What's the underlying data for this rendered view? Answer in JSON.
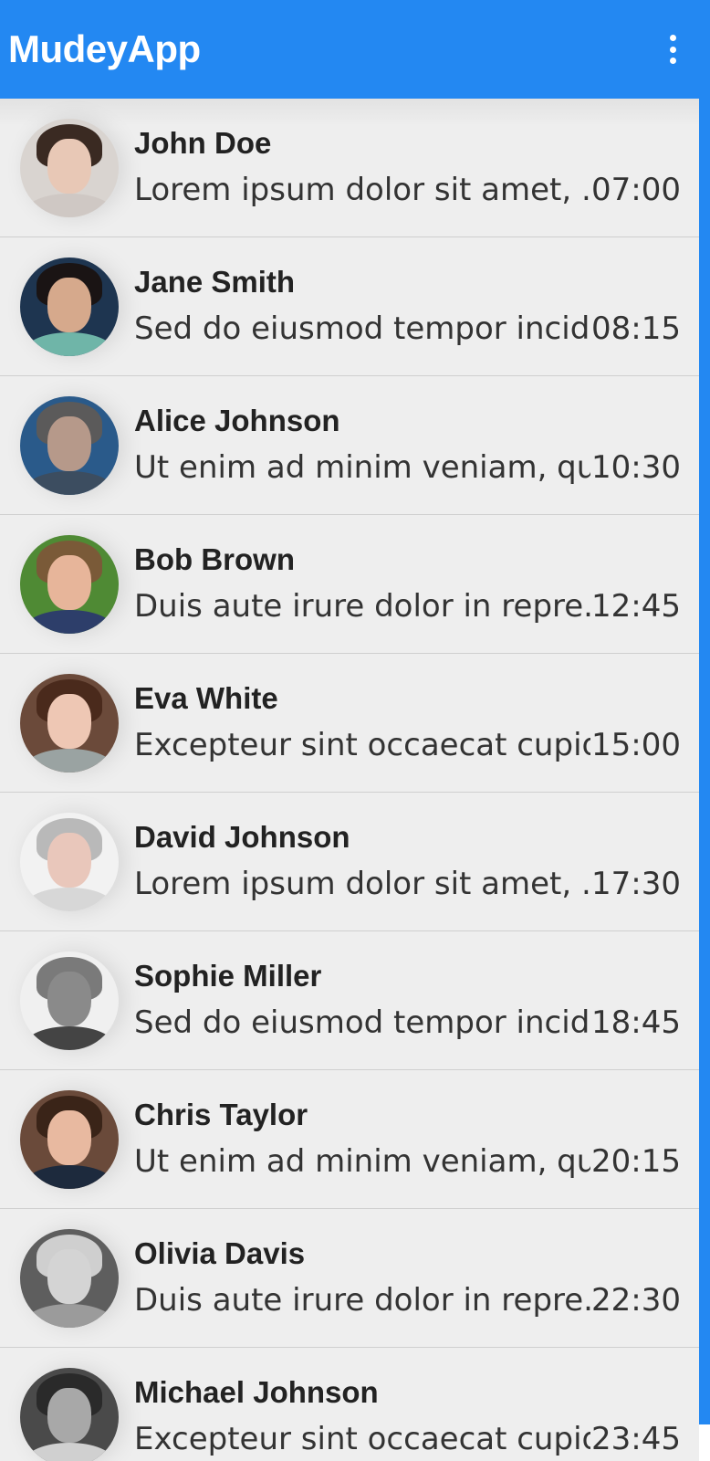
{
  "app": {
    "title": "MudeyApp",
    "colors": {
      "accent": "#2388f2",
      "row_background": "#eeeeee",
      "divider": "#cfcfcf"
    }
  },
  "toolbar": {
    "menu_icon": "more-vert-icon"
  },
  "chats": [
    {
      "name": "John Doe",
      "message": "Lorem ipsum dolor sit amet, ...",
      "time": "07:00",
      "avatar": {
        "bg": "#d9d4d0",
        "hair": "#3a2a22",
        "skin": "#e8c8b6",
        "shirt": "#cfc8c4"
      }
    },
    {
      "name": "Jane Smith",
      "message": "Sed do eiusmod tempor incid...",
      "time": "08:15",
      "avatar": {
        "bg": "#1e3550",
        "hair": "#1a1414",
        "skin": "#d6a98c",
        "shirt": "#6fb5a8"
      }
    },
    {
      "name": "Alice Johnson",
      "message": "Ut enim ad minim veniam, qu...",
      "time": "10:30",
      "avatar": {
        "bg": "#2a5a8a",
        "hair": "#5b5a5a",
        "skin": "#b6998a",
        "shirt": "#3c4d60"
      }
    },
    {
      "name": "Bob Brown",
      "message": "Duis aute irure dolor in repre...",
      "time": "12:45",
      "avatar": {
        "bg": "#4f8a34",
        "hair": "#7a5a38",
        "skin": "#e7b59a",
        "shirt": "#2d3e6a"
      }
    },
    {
      "name": "Eva White",
      "message": "Excepteur sint occaecat cupid...",
      "time": "15:00",
      "avatar": {
        "bg": "#6b4a3a",
        "hair": "#4a2a1c",
        "skin": "#eec7b4",
        "shirt": "#9aa3a2"
      }
    },
    {
      "name": "David Johnson",
      "message": "Lorem ipsum dolor sit amet, ...",
      "time": "17:30",
      "avatar": {
        "bg": "#f2f2f2",
        "hair": "#b9b9b9",
        "skin": "#e9c7bb",
        "shirt": "#d7d7d7"
      }
    },
    {
      "name": "Sophie Miller",
      "message": "Sed do eiusmod tempor incid...",
      "time": "18:45",
      "avatar": {
        "bg": "#f0f0f0",
        "hair": "#7a7a7a",
        "skin": "#8a8a8a",
        "shirt": "#444444"
      }
    },
    {
      "name": "Chris Taylor",
      "message": "Ut enim ad minim veniam, qu...",
      "time": "20:15",
      "avatar": {
        "bg": "#6a4a3a",
        "hair": "#3a2418",
        "skin": "#e8b9a0",
        "shirt": "#1d2a3d"
      }
    },
    {
      "name": "Olivia Davis",
      "message": "Duis aute irure dolor in repre...",
      "time": "22:30",
      "avatar": {
        "bg": "#5e5e5e",
        "hair": "#cfcfcf",
        "skin": "#d4d4d4",
        "shirt": "#9b9b9b"
      }
    },
    {
      "name": "Michael Johnson",
      "message": "Excepteur sint occaecat cupid...",
      "time": "23:45",
      "avatar": {
        "bg": "#4a4a4a",
        "hair": "#2a2a2a",
        "skin": "#a8a8a8",
        "shirt": "#d0d0d0"
      }
    }
  ]
}
